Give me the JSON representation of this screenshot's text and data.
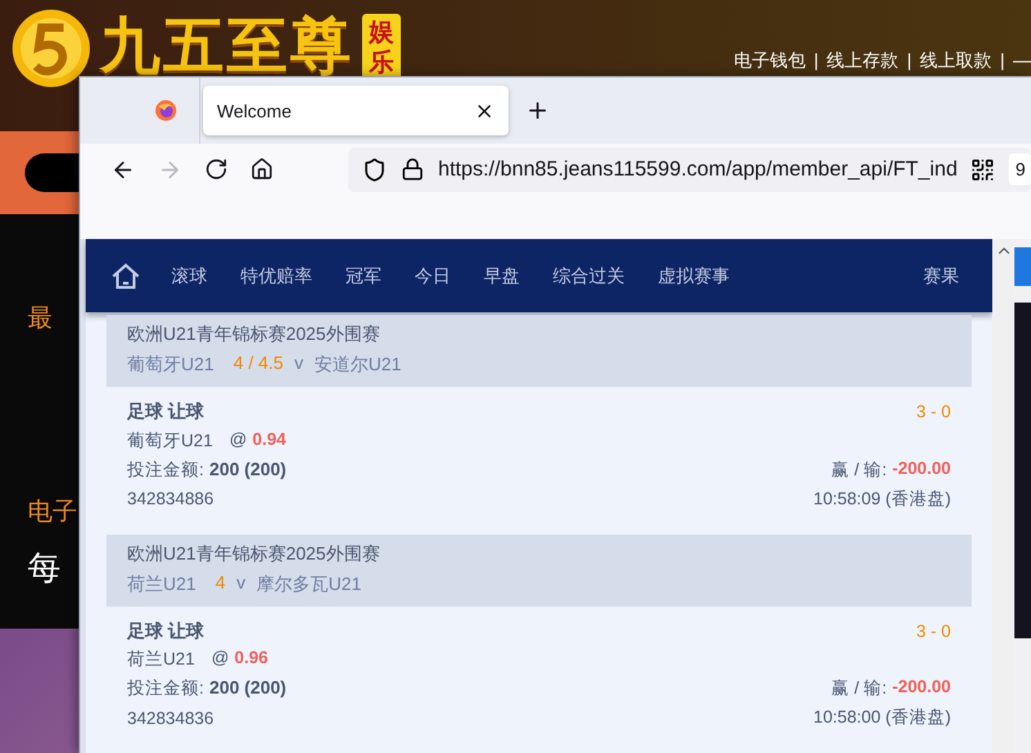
{
  "background": {
    "logo_text": "九五至尊",
    "logo_badge": "娱乐",
    "top_links": [
      "电子钱包",
      "|",
      "线上存款",
      "|",
      "线上取款",
      "|",
      "—"
    ],
    "side_texts": [
      {
        "kind": "orange",
        "text": "最"
      },
      {
        "kind": "orange",
        "text": "电子"
      },
      {
        "kind": "white",
        "text": "每"
      }
    ]
  },
  "browser": {
    "tabs": [
      {
        "title": "Welcome",
        "selected": true
      }
    ],
    "toolbar_buttons": [
      {
        "kind": "back",
        "disabled": false
      },
      {
        "kind": "forward",
        "disabled": true
      },
      {
        "kind": "reload",
        "disabled": false
      },
      {
        "kind": "home",
        "disabled": false
      }
    ],
    "url": "https://bnn85.jeans115599.com/app/member_api/FT_ind",
    "toolbar_item_text": "9"
  },
  "nav": {
    "items": [
      {
        "label": "滚球",
        "selected": false
      },
      {
        "label": "特优赔率",
        "selected": false
      },
      {
        "label": "冠军",
        "selected": false
      },
      {
        "label": "今日",
        "selected": false
      },
      {
        "label": "早盘",
        "selected": false
      },
      {
        "label": "综合过关",
        "selected": false
      },
      {
        "label": "虚拟赛事",
        "selected": false
      }
    ],
    "right_item": {
      "label": "赛果",
      "selected": false
    }
  },
  "bets": [
    {
      "league": "欧洲U21青年锦标赛2025外围赛",
      "home": "葡萄牙U21",
      "handicap": "4 / 4.5",
      "versus": "v",
      "away": "安道尔U21",
      "market": "足球 让球",
      "score": "3 - 0",
      "pick": "葡萄牙U21",
      "at": "@",
      "odds": "0.94",
      "stake_label": "投注金额:",
      "stake": "200 (200)",
      "result_label": "赢 / 输:",
      "result": "-200.00",
      "ticket": "342834886",
      "time": "10:58:09 (香港盘)"
    },
    {
      "league": "欧洲U21青年锦标赛2025外围赛",
      "home": "荷兰U21",
      "handicap": "4",
      "versus": "v",
      "away": "摩尔多瓦U21",
      "market": "足球 让球",
      "score": "3 - 0",
      "pick": "荷兰U21",
      "at": "@",
      "odds": "0.96",
      "stake_label": "投注金额:",
      "stake": "200 (200)",
      "result_label": "赢 / 输:",
      "result": "-200.00",
      "ticket": "342834836",
      "time": "10:58:00 (香港盘)"
    }
  ]
}
